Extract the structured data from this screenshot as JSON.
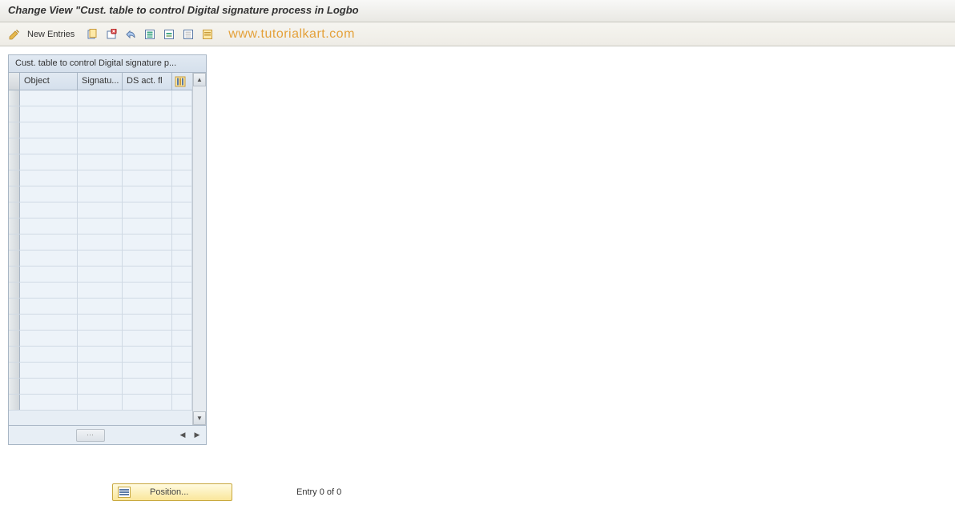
{
  "title": "Change View \"Cust. table to control Digital signature process in Logbo",
  "toolbar": {
    "new_entries_label": "New Entries"
  },
  "watermark": "www.tutorialkart.com",
  "panel": {
    "header": "Cust. table to control Digital signature p...",
    "columns": {
      "object": "Object",
      "signature": "Signatu...",
      "ds_act": "DS act. fl"
    },
    "row_count": 20
  },
  "footer": {
    "position_label": "Position...",
    "entry_label": "Entry 0 of 0"
  }
}
